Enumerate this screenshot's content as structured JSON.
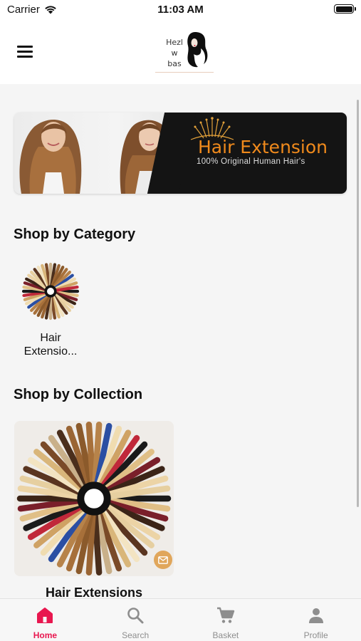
{
  "status_bar": {
    "carrier": "Carrier",
    "time": "11:03 AM"
  },
  "header": {
    "logo_text": "Hezl w bas"
  },
  "banner": {
    "title": "Hair Extension",
    "subtitle": "100% Original Human Hair's"
  },
  "categories_section": {
    "title": "Shop by Category",
    "items": [
      {
        "label": "Hair Extensio..."
      }
    ]
  },
  "collections_section": {
    "title": "Shop by Collection",
    "items": [
      {
        "label": "Hair Extensions"
      }
    ]
  },
  "tab_bar": {
    "tabs": [
      {
        "label": "Home",
        "icon": "home-icon",
        "active": true
      },
      {
        "label": "Search",
        "icon": "search-icon",
        "active": false
      },
      {
        "label": "Basket",
        "icon": "cart-icon",
        "active": false
      },
      {
        "label": "Profile",
        "icon": "person-icon",
        "active": false
      }
    ]
  },
  "colors": {
    "accent": "#e8174f",
    "banner_title": "#f08a1c",
    "inactive_tab": "#8e8e8e"
  }
}
